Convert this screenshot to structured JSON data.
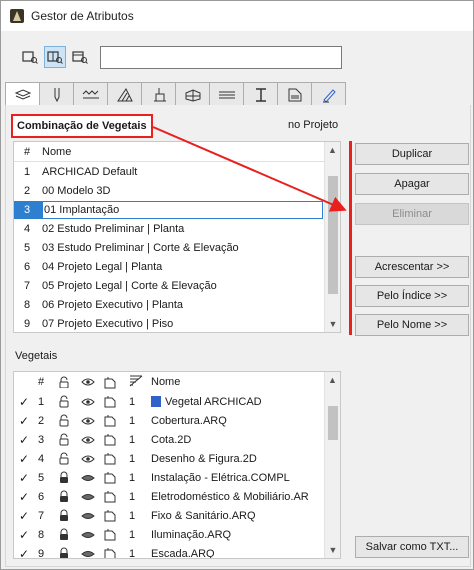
{
  "window": {
    "title": "Gestor de Atributos"
  },
  "search": {
    "value": "",
    "placeholder": ""
  },
  "toolbar": {
    "view_buttons": [
      {
        "icon": "list-view-icon",
        "active": false
      },
      {
        "icon": "split-view-icon",
        "active": true
      },
      {
        "icon": "detail-view-icon",
        "active": false
      }
    ]
  },
  "tabs": [
    {
      "icon": "layers-icon",
      "active": true
    },
    {
      "icon": "pen-icon",
      "active": false
    },
    {
      "icon": "line-type-icon",
      "active": false
    },
    {
      "icon": "fill-icon",
      "active": false
    },
    {
      "icon": "paint-bucket-icon",
      "active": false
    },
    {
      "icon": "building-material-icon",
      "active": false
    },
    {
      "icon": "surface-icon",
      "active": false
    },
    {
      "icon": "profile-icon",
      "active": false
    },
    {
      "icon": "zone-icon",
      "active": false
    },
    {
      "icon": "markup-icon",
      "active": false
    }
  ],
  "combination": {
    "title": "Combinação de Vegetais",
    "scope": "no Projeto",
    "header_num": "#",
    "header_name": "Nome",
    "rows": [
      {
        "num": "1",
        "name": " ARCHICAD Default",
        "selected": false
      },
      {
        "num": "2",
        "name": "00 Modelo 3D",
        "selected": false
      },
      {
        "num": "3",
        "name": "01 Implantação",
        "selected": true
      },
      {
        "num": "4",
        "name": "02 Estudo Preliminar | Planta",
        "selected": false
      },
      {
        "num": "5",
        "name": "03 Estudo Preliminar | Corte & Elevação",
        "selected": false
      },
      {
        "num": "6",
        "name": "04 Projeto Legal | Planta",
        "selected": false
      },
      {
        "num": "7",
        "name": "05 Projeto Legal | Corte & Elevação",
        "selected": false
      },
      {
        "num": "8",
        "name": "06 Projeto Executivo | Planta",
        "selected": false
      },
      {
        "num": "9",
        "name": "07 Projeto Executivo | Piso",
        "selected": false
      }
    ]
  },
  "buttons": {
    "duplicar": "Duplicar",
    "apagar": "Apagar",
    "eliminar": "Eliminar",
    "acrescentar": "Acrescentar >>",
    "pelo_indice": "Pelo Índice >>",
    "pelo_nome": "Pelo Nome >>",
    "salvar": "Salvar como TXT..."
  },
  "layers": {
    "label": "Vegetais",
    "header_num": "#",
    "header_name": "Nome",
    "rows": [
      {
        "num": "1",
        "pen": "1",
        "name": "Vegetal ARCHICAD",
        "locked": false,
        "swatch": true
      },
      {
        "num": "2",
        "pen": "1",
        "name": "Cobertura.ARQ",
        "locked": false,
        "swatch": false
      },
      {
        "num": "3",
        "pen": "1",
        "name": "Cota.2D",
        "locked": false,
        "swatch": false
      },
      {
        "num": "4",
        "pen": "1",
        "name": "Desenho & Figura.2D",
        "locked": false,
        "swatch": false
      },
      {
        "num": "5",
        "pen": "1",
        "name": "Instalação - Elétrica.COMPL",
        "locked": true,
        "swatch": false
      },
      {
        "num": "6",
        "pen": "1",
        "name": "Eletrodoméstico & Mobiliário.AR",
        "locked": true,
        "swatch": false
      },
      {
        "num": "7",
        "pen": "1",
        "name": "Fixo & Sanitário.ARQ",
        "locked": true,
        "swatch": false
      },
      {
        "num": "8",
        "pen": "1",
        "name": "Iluminação.ARQ",
        "locked": true,
        "swatch": false
      },
      {
        "num": "9",
        "pen": "1",
        "name": "Escada.ARQ",
        "locked": true,
        "swatch": false
      }
    ]
  },
  "colors": {
    "accent_red": "#e8201e",
    "selection_blue": "#2f7fd1"
  }
}
